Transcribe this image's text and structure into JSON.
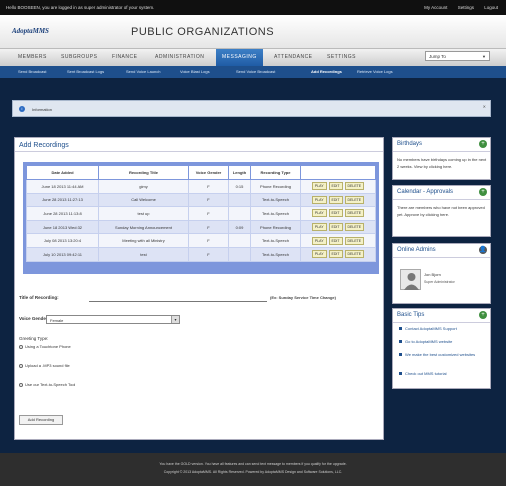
{
  "topbar": {
    "message": "Hello BOOSEEN, you are logged in as super administrator of your system.",
    "links": [
      "My Account",
      "Settings",
      "Logout"
    ]
  },
  "header": {
    "logo": "AdoptaMMS",
    "title": "PUBLIC ORGANIZATIONS"
  },
  "nav": {
    "items": [
      "MEMBERS",
      "SUBGROUPS",
      "FINANCE",
      "ADMINISTRATION",
      "MESSAGING",
      "ATTENDANCE",
      "SETTINGS"
    ],
    "active": "MESSAGING",
    "jump_to": "Jump To"
  },
  "subnav": {
    "items": [
      "Send Broadcast",
      "Sent Broadcast Logs",
      "Send Voice Launch",
      "Voice Blast Logs",
      "Send Voice Broadcast",
      "Add Recordings",
      "Retrieve Voice Logs"
    ],
    "active": "Add Recordings"
  },
  "info": {
    "label": "Information"
  },
  "recordings": {
    "title": "Add Recordings",
    "columns": [
      "Date Added",
      "Recording Title",
      "Voice Gender",
      "Length",
      "Recording Type",
      ""
    ],
    "rows": [
      {
        "date": "June 18 2013 11:44 AM",
        "title": "gimy",
        "gender": "F",
        "length": "0:15",
        "type": "Phone Recording"
      },
      {
        "date": "June 28 2013 11:27:13",
        "title": "Call Welcome",
        "gender": "F",
        "length": "",
        "type": "Text-to-Speech"
      },
      {
        "date": "June 28 2013 11:13:8",
        "title": "test up",
        "gender": "F",
        "length": "",
        "type": "Text-to-Speech"
      },
      {
        "date": "June 18 2013 Wed:32",
        "title": "Sunday Morning Announcement",
        "gender": "F",
        "length": "0:09",
        "type": "Phone Recording"
      },
      {
        "date": "July 08 2013 13:20:4",
        "title": "Meeting with all Ministry",
        "gender": "F",
        "length": "",
        "type": "Text-to-Speech"
      },
      {
        "date": "July 10 2013 09:42:11",
        "title": "test",
        "gender": "F",
        "length": "",
        "type": "Text-to-Speech"
      }
    ],
    "actions": [
      "PLAY",
      "EDIT",
      "DELETE"
    ],
    "form": {
      "title_label": "Title of Recording:",
      "title_hint": "(Ex: Sunday Service Time Change)",
      "gender_label": "Voice Gender:",
      "gender_value": "Female",
      "greeting_label": "Greeting Type:",
      "opt1": "Using a Touchtone Phone",
      "opt2": "Upload a .MP3 sound file",
      "opt3": "Use our Text-to-Speech Tool",
      "add_button": "Add Recording"
    }
  },
  "sidebar": {
    "birthdays": {
      "title": "Birthdays",
      "text": "No members have birthdays coming up in the next 2 weeks. View by clicking here."
    },
    "calendar": {
      "title": "Calendar - Approvals",
      "text": "There are members who have not been approved yet. Approve by clicking here."
    },
    "online": {
      "title": "Online Admins",
      "name": "Jon Bjorn",
      "role": "Super Administrator"
    },
    "tips": {
      "title": "Basic Tips",
      "items": [
        "Contact AdoptaMMS Support",
        "Go to AdoptaMMS website",
        "We make the best customized websites",
        "Check out MMS tutorial"
      ]
    }
  },
  "footer": {
    "line1": "You have the GOLD version. You have all features and can send text message to members if you qualify for the upgrade.",
    "line2": "Copyright © 2013 AdoptaMMS. All Rights Reserved. Powered by AdoptaMMS Design and Software Solutions, LLC."
  }
}
